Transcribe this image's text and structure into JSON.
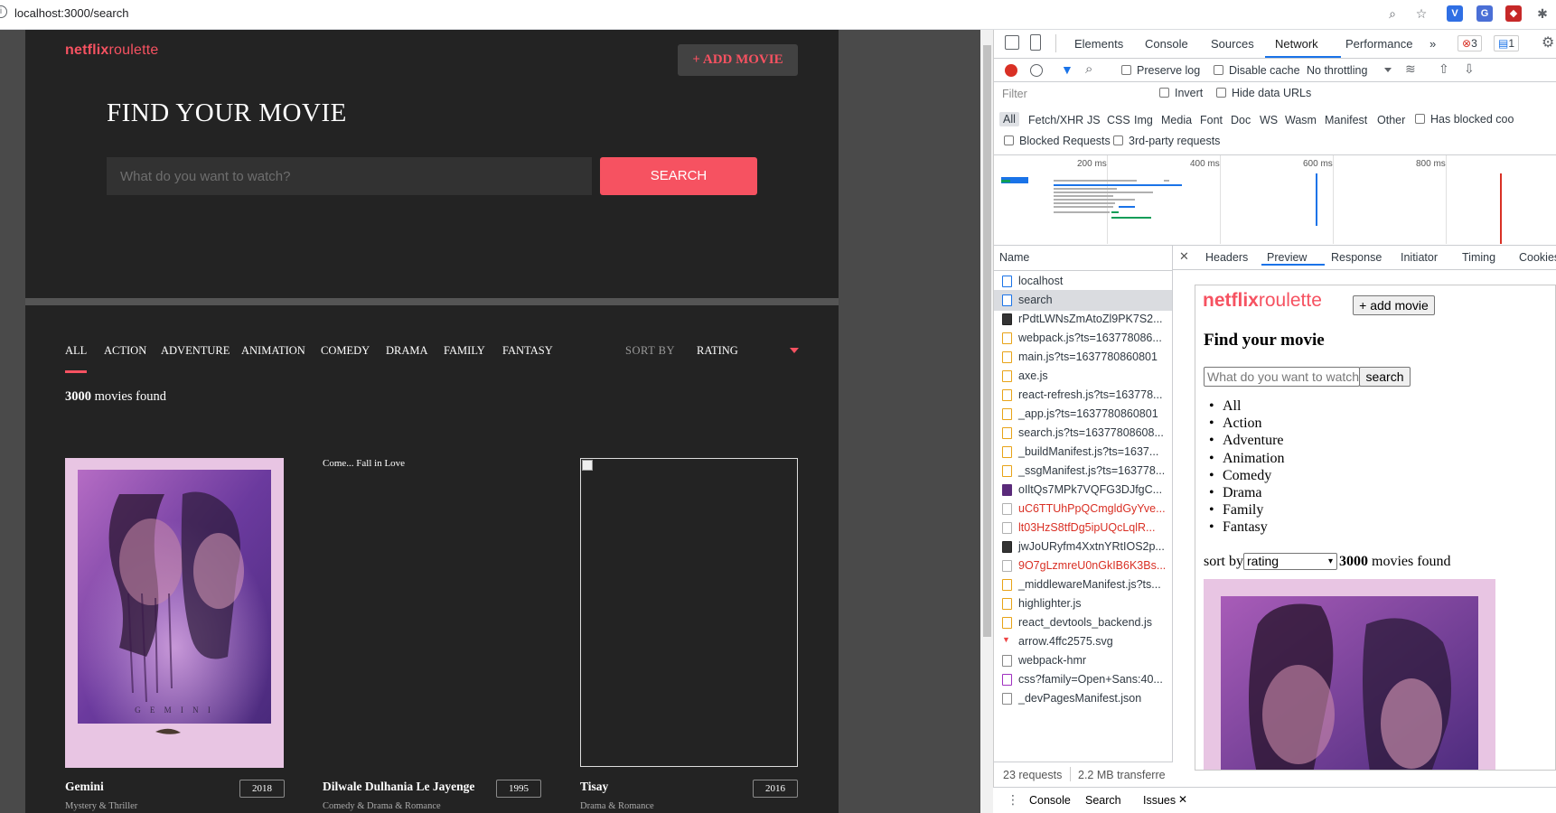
{
  "browser": {
    "url": "localhost:3000/search",
    "colors": {
      "v_ext": "#2f6fe4",
      "translate_ext": "#4a6fd6",
      "red_ext": "#c62828"
    }
  },
  "app": {
    "logo_bold": "netflix",
    "logo_rest": "roulette",
    "add_movie": "+ ADD MOVIE",
    "find_title": "FIND YOUR MOVIE",
    "search_placeholder": "What do you want to watch?",
    "search_button": "SEARCH",
    "genres": [
      "ALL",
      "ACTION",
      "ADVENTURE",
      "ANIMATION",
      "COMEDY",
      "DRAMA",
      "FAMILY",
      "FANTASY"
    ],
    "sort_label": "SORT BY",
    "sort_value": "RATING",
    "found_count": "3000",
    "found_text": " movies found",
    "movies": [
      {
        "title": "Gemini",
        "year": "2018",
        "genres": "Mystery & Thriller",
        "poster_text": "G E M I N I"
      },
      {
        "title": "Dilwale Dulhania Le Jayenge",
        "year": "1995",
        "genres": "Comedy & Drama & Romance",
        "alt": "Come... Fall in Love"
      },
      {
        "title": "Tisay",
        "year": "2016",
        "genres": "Drama & Romance"
      }
    ],
    "colors": {
      "accent": "#f65261",
      "background": "#232323"
    }
  },
  "devtools": {
    "tabs": [
      "Elements",
      "Console",
      "Sources",
      "Network",
      "Performance"
    ],
    "active_tab": "Network",
    "errors": "3",
    "messages": "1",
    "toolbar": {
      "preserve_log": "Preserve log",
      "disable_cache": "Disable cache",
      "throttling": "No throttling"
    },
    "filter_placeholder": "Filter",
    "invert": "Invert",
    "hide_data_urls": "Hide data URLs",
    "types": [
      "All",
      "Fetch/XHR",
      "JS",
      "CSS",
      "Img",
      "Media",
      "Font",
      "Doc",
      "WS",
      "Wasm",
      "Manifest",
      "Other"
    ],
    "has_blocked": "Has blocked coo",
    "blocked_requests": "Blocked Requests",
    "third_party": "3rd-party requests",
    "ticks": [
      "200 ms",
      "400 ms",
      "600 ms",
      "800 ms"
    ],
    "name_header": "Name",
    "requests": [
      {
        "name": "localhost",
        "kind": "doc"
      },
      {
        "name": "search",
        "kind": "doc"
      },
      {
        "name": "rPdtLWNsZmAtoZl9PK7S2...",
        "kind": "img"
      },
      {
        "name": "webpack.js?ts=163778086...",
        "kind": "js"
      },
      {
        "name": "main.js?ts=1637780860801",
        "kind": "js"
      },
      {
        "name": "axe.js",
        "kind": "js"
      },
      {
        "name": "react-refresh.js?ts=163778...",
        "kind": "js"
      },
      {
        "name": "_app.js?ts=1637780860801",
        "kind": "js"
      },
      {
        "name": "search.js?ts=16377808608...",
        "kind": "js"
      },
      {
        "name": "_buildManifest.js?ts=1637...",
        "kind": "js"
      },
      {
        "name": "_ssgManifest.js?ts=163778...",
        "kind": "js"
      },
      {
        "name": "oIltQs7MPk7VQFG3DJfgC...",
        "kind": "purple"
      },
      {
        "name": "uC6TTUhPpQCmgldGyYve...",
        "kind": "red"
      },
      {
        "name": "lt03HzS8tfDg5ipUQcLqlR...",
        "kind": "red"
      },
      {
        "name": "jwJoURyfm4XxtnYRtIOS2p...",
        "kind": "img"
      },
      {
        "name": "9O7gLzmreU0nGkIB6K3Bs...",
        "kind": "red"
      },
      {
        "name": "_middlewareManifest.js?ts...",
        "kind": "js"
      },
      {
        "name": "highlighter.js",
        "kind": "js"
      },
      {
        "name": "react_devtools_backend.js",
        "kind": "js"
      },
      {
        "name": "arrow.4ffc2575.svg",
        "kind": "svg"
      },
      {
        "name": "webpack-hmr",
        "kind": "plain"
      },
      {
        "name": "css?family=Open+Sans:40...",
        "kind": "css"
      },
      {
        "name": "_devPagesManifest.json",
        "kind": "plain"
      }
    ],
    "selected_request": "search",
    "detail_tabs": [
      "Headers",
      "Preview",
      "Response",
      "Initiator",
      "Timing",
      "Cookies"
    ],
    "active_detail_tab": "Preview",
    "preview": {
      "add_movie": "+ add movie",
      "find_title": "Find your movie",
      "search_placeholder": "What do you want to watch?",
      "search_button": "search",
      "genres": [
        "All",
        "Action",
        "Adventure",
        "Animation",
        "Comedy",
        "Drama",
        "Family",
        "Fantasy"
      ],
      "sort_label": "sort by",
      "sort_value": "rating",
      "found_count": "3000",
      "found_text": " movies found"
    },
    "status": {
      "requests": "23 requests",
      "transferred": "2.2 MB transferre"
    },
    "drawer": {
      "console": "Console",
      "search": "Search",
      "issues": "Issues"
    }
  }
}
